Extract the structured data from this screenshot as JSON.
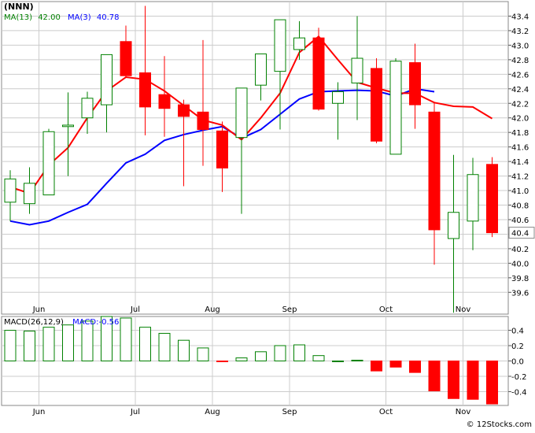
{
  "ticker": "(NNN)",
  "legend": {
    "ma13_label": "MA(13)",
    "ma13_value": "42.00",
    "ma3_label": "MA(3)",
    "ma3_value": "40.78"
  },
  "macd_legend": {
    "params": "MACD(26,12,9)",
    "value_label": "MACD:-0.56"
  },
  "last_price_label": "40.4",
  "watermark": "© 12Stocks.com",
  "colors": {
    "up": "#008000",
    "down": "#ff0000",
    "ma13": "#0000ff",
    "ma3": "#ff0000",
    "grid": "#cccccc"
  },
  "chart_data": [
    {
      "type": "candlestick",
      "x_ticks": [
        {
          "label": "Jun",
          "at": 1
        },
        {
          "label": "Jul",
          "at": 6
        },
        {
          "label": "Aug",
          "at": 10
        },
        {
          "label": "Sep",
          "at": 14
        },
        {
          "label": "Oct",
          "at": 19
        },
        {
          "label": "Nov",
          "at": 23
        }
      ],
      "ylim": [
        39.3,
        43.6
      ],
      "y_ticks": [
        39.6,
        39.8,
        40.0,
        40.2,
        40.4,
        40.6,
        40.8,
        41.0,
        41.2,
        41.4,
        41.6,
        41.8,
        42.0,
        42.2,
        42.4,
        42.6,
        42.8,
        43.0,
        43.2,
        43.4
      ],
      "candles": [
        {
          "o": 40.84,
          "h": 41.28,
          "l": 40.58,
          "c": 41.16
        },
        {
          "o": 40.82,
          "h": 41.32,
          "l": 40.68,
          "c": 41.1
        },
        {
          "o": 40.94,
          "h": 41.85,
          "l": 40.94,
          "c": 41.81
        },
        {
          "o": 41.88,
          "h": 42.35,
          "l": 41.2,
          "c": 41.9
        },
        {
          "o": 42.0,
          "h": 42.36,
          "l": 41.78,
          "c": 42.27
        },
        {
          "o": 42.18,
          "h": 42.85,
          "l": 41.8,
          "c": 42.87
        },
        {
          "o": 43.05,
          "h": 43.27,
          "l": 42.55,
          "c": 42.58
        },
        {
          "o": 42.62,
          "h": 43.54,
          "l": 41.76,
          "c": 42.15
        },
        {
          "o": 42.32,
          "h": 42.85,
          "l": 41.74,
          "c": 42.13
        },
        {
          "o": 42.18,
          "h": 42.25,
          "l": 41.06,
          "c": 42.02
        },
        {
          "o": 42.08,
          "h": 43.07,
          "l": 41.34,
          "c": 41.84
        },
        {
          "o": 41.82,
          "h": 41.95,
          "l": 40.98,
          "c": 41.31
        },
        {
          "o": 41.73,
          "h": 42.4,
          "l": 40.68,
          "c": 42.41
        },
        {
          "o": 42.45,
          "h": 42.88,
          "l": 42.24,
          "c": 42.88
        },
        {
          "o": 42.64,
          "h": 43.35,
          "l": 41.84,
          "c": 43.35
        },
        {
          "o": 42.94,
          "h": 43.33,
          "l": 42.8,
          "c": 43.1
        },
        {
          "o": 43.1,
          "h": 43.24,
          "l": 42.1,
          "c": 42.12
        },
        {
          "o": 42.2,
          "h": 42.49,
          "l": 41.7,
          "c": 42.36
        },
        {
          "o": 42.48,
          "h": 43.4,
          "l": 41.97,
          "c": 42.82
        },
        {
          "o": 42.68,
          "h": 42.82,
          "l": 41.65,
          "c": 41.68
        },
        {
          "o": 41.5,
          "h": 42.82,
          "l": 41.5,
          "c": 42.78
        },
        {
          "o": 42.76,
          "h": 43.02,
          "l": 41.85,
          "c": 42.18
        },
        {
          "o": 42.08,
          "h": 42.22,
          "l": 39.98,
          "c": 40.46
        },
        {
          "o": 40.34,
          "h": 41.49,
          "l": 39.32,
          "c": 40.7
        },
        {
          "o": 40.58,
          "h": 41.45,
          "l": 40.18,
          "c": 41.22
        },
        {
          "o": 41.36,
          "h": 41.46,
          "l": 40.36,
          "c": 40.42
        }
      ],
      "series": [
        {
          "key": "ma13",
          "name": "MA(13)",
          "start": 0,
          "values": [
            40.58,
            40.53,
            40.58,
            40.7,
            40.81,
            41.1,
            41.38,
            41.5,
            41.69,
            41.77,
            41.83,
            41.88,
            41.72,
            41.84,
            42.05,
            42.26,
            42.36,
            42.37,
            42.38,
            42.37,
            42.3,
            42.4,
            42.36
          ]
        },
        {
          "key": "ma3",
          "name": "MA(3)",
          "start": 0,
          "values": [
            41.05,
            40.96,
            41.35,
            41.59,
            42.0,
            42.37,
            42.56,
            42.53,
            42.37,
            42.17,
            41.97,
            41.9,
            41.7,
            42.0,
            42.34,
            42.9,
            43.12,
            42.8,
            42.49,
            42.41,
            42.34,
            42.34,
            42.21,
            42.16,
            42.15,
            41.99
          ]
        }
      ]
    },
    {
      "type": "bar",
      "title": "MACD(26,12,9)",
      "ylim": [
        -0.58,
        0.58
      ],
      "y_ticks": [
        -0.4,
        -0.2,
        0.0,
        0.2,
        0.4
      ],
      "values": [
        0.4,
        0.39,
        0.44,
        0.47,
        0.52,
        0.58,
        0.56,
        0.44,
        0.36,
        0.27,
        0.17,
        -0.01,
        0.04,
        0.12,
        0.2,
        0.21,
        0.07,
        0.0,
        0.01,
        -0.13,
        -0.08,
        -0.15,
        -0.39,
        -0.49,
        -0.5,
        -0.56
      ]
    }
  ]
}
